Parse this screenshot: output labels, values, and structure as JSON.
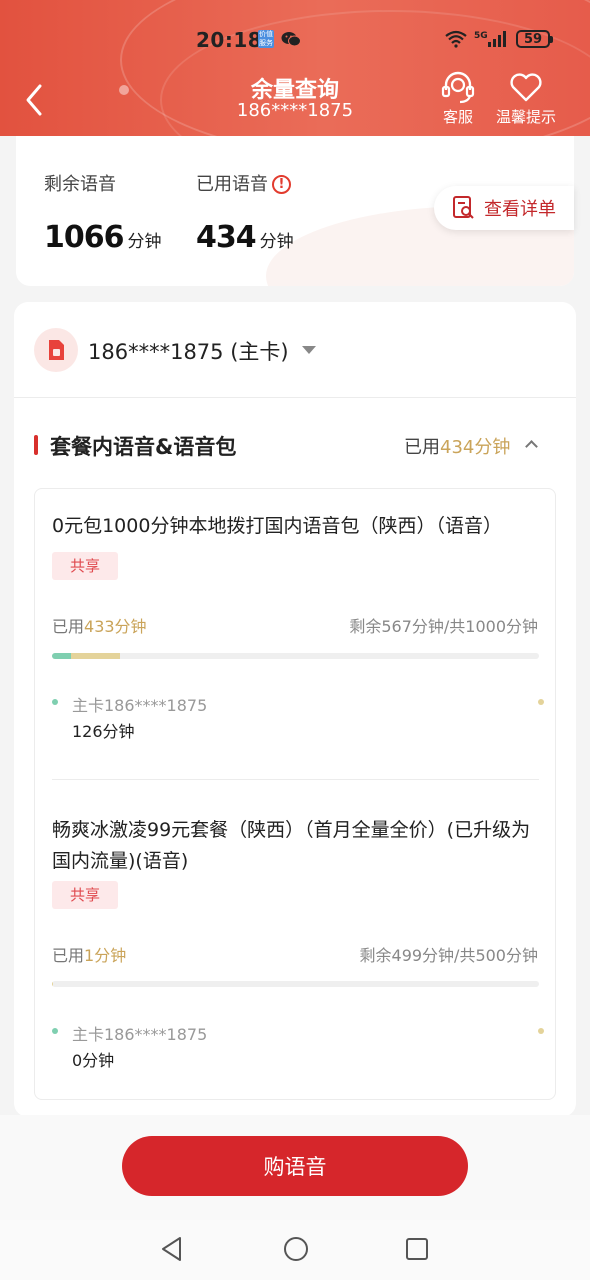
{
  "status_bar": {
    "time": "20:18",
    "app_badge": "价值\n服务",
    "battery": "59",
    "network": "5G"
  },
  "header": {
    "title": "余量查询",
    "subtitle": "186****1875",
    "service_label": "客服",
    "tips_label": "温馨提示"
  },
  "summary": {
    "remaining_label": "剩余语音",
    "remaining_value": "1066",
    "remaining_unit": "分钟",
    "used_label": "已用语音",
    "used_value": "434",
    "used_unit": "分钟",
    "detail_button": "查看详单"
  },
  "sim": {
    "number": "186****1875 (主卡)"
  },
  "section": {
    "title": "套餐内语音&语音包",
    "used_prefix": "已用",
    "used_value": "434分钟"
  },
  "packages": [
    {
      "name": "0元包1000分钟本地拨打国内语音包（陕西）（语音）",
      "tag": "共享",
      "used_prefix": "已用",
      "used_value": "433分钟",
      "remaining": "剩余567分钟/共1000分钟",
      "progress_green_fraction": 0.04,
      "progress_yellow_fraction": 0.1,
      "member_name": "主卡186****1875",
      "member_value": "126分钟"
    },
    {
      "name": "畅爽冰激凌99元套餐（陕西）（首月全量全价）(已升级为国内流量)(语音)",
      "tag": "共享",
      "used_prefix": "已用",
      "used_value": "1分钟",
      "remaining": "剩余499分钟/共500分钟",
      "progress_green_fraction": 0.0,
      "progress_yellow_fraction": 0.002,
      "member_name": "主卡186****1875",
      "member_value": "0分钟"
    }
  ],
  "bottom": {
    "buy_button": "购语音"
  },
  "colors": {
    "brand_red": "#d6262b",
    "gold": "#caa45a",
    "green": "#7fcfb0",
    "yellow": "#e4d39a"
  }
}
